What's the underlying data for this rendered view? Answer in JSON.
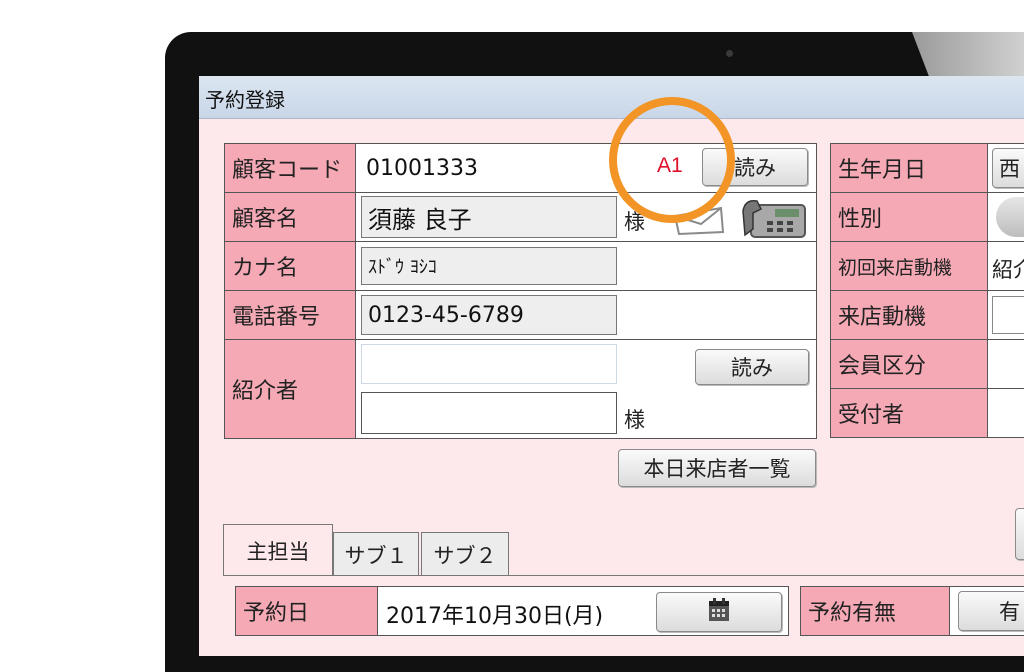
{
  "window": {
    "title": "予約登録"
  },
  "customer": {
    "code_label": "顧客コード",
    "code_value": "01001333",
    "rank": "A1",
    "read_button": "読み",
    "name_label": "顧客名",
    "name_value": "須藤 良子",
    "honorific": "様",
    "kana_label": "カナ名",
    "kana_value": "ｽﾄﾞｳ ﾖｼｺ",
    "phone_label": "電話番号",
    "phone_value": "0123-45-6789",
    "referrer_label": "紹介者",
    "referrer_value": "",
    "referrer_name": "",
    "referrer_read_button": "読み",
    "referrer_honorific": "様",
    "today_visitors_button": "本日来店者一覧"
  },
  "right_panel": {
    "birthday_label": "生年月日",
    "birthday_value_fragment": "西",
    "gender_label": "性別",
    "first_visit_motive_label": "初回来店動機",
    "first_visit_motive_value_fragment": "紹介",
    "visit_motive_label": "来店動機",
    "member_class_label": "会員区分",
    "receptionist_label": "受付者"
  },
  "tabs": [
    {
      "label": "主担当"
    },
    {
      "label": "サブ１"
    },
    {
      "label": "サブ２"
    }
  ],
  "reservation": {
    "date_label": "予約日",
    "date_value": "2017年10月30日(月)",
    "exists_label": "予約有無",
    "exists_value_fragment": "有"
  },
  "colors": {
    "label_bg": "#f4a9b5",
    "panel_bg": "#fde9ec",
    "highlight_ring": "#f29526",
    "rank_text": "#e0102a"
  },
  "icons": [
    "envelope-icon",
    "phone-icon",
    "calendar-icon",
    "gender-icon"
  ]
}
